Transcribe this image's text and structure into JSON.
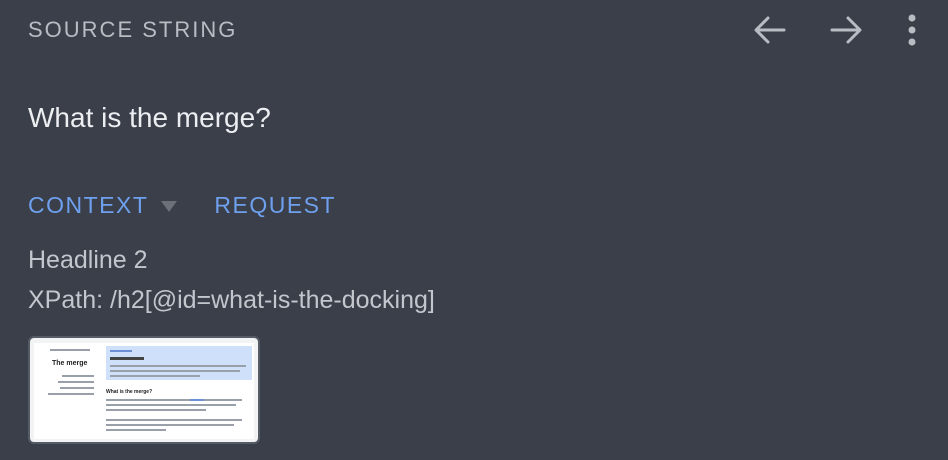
{
  "header": {
    "title": "SOURCE STRING",
    "icons": [
      "arrow-left-icon",
      "arrow-right-icon",
      "more-vert-icon"
    ]
  },
  "source": {
    "text": "What is the merge?"
  },
  "tabs": [
    {
      "label": "CONTEXT",
      "expanded": true
    },
    {
      "label": "REQUEST"
    }
  ],
  "context": {
    "type": "Headline 2",
    "xpath": "XPath: /h2[@id=what-is-the-docking]"
  },
  "screenshot_thumb": {
    "doc_title": "The merge",
    "section_heading": "What is the merge?"
  },
  "colors": {
    "background": "#3a3f4a",
    "accent": "#6ea0ee",
    "muted_text": "#b9bcc3"
  }
}
